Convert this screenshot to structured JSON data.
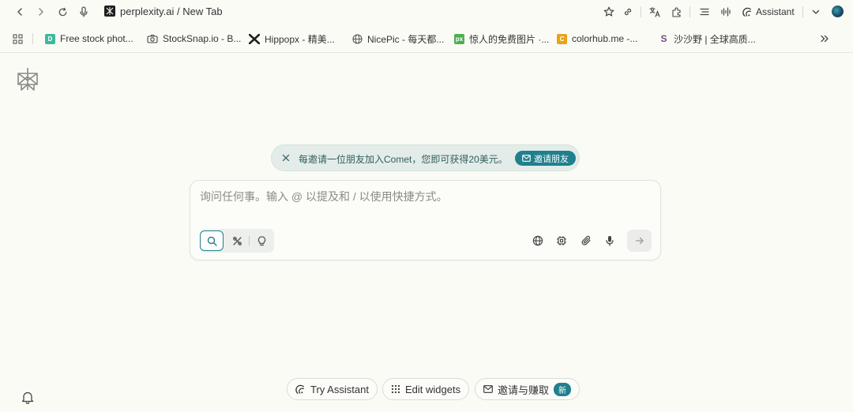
{
  "toolbar": {
    "tab_title": "perplexity.ai / New Tab",
    "assistant_label": "Assistant"
  },
  "bookmarks": [
    {
      "label": "Free stock phot...",
      "favicon_text": "D",
      "color": "#3fb8a0"
    },
    {
      "label": "StockSnap.io - B...",
      "favicon_text": "",
      "color": "#444444"
    },
    {
      "label": "Hippopx - 精美...",
      "favicon_text": "",
      "color": "#222222"
    },
    {
      "label": "NicePic - 每天都...",
      "favicon_text": "",
      "color": "#555555"
    },
    {
      "label": "惊人的免费图片 ·...",
      "favicon_text": "px",
      "color": "#4caf50"
    },
    {
      "label": "colorhub.me -...",
      "favicon_text": "C",
      "color": "#e8a317"
    },
    {
      "label": "沙沙野 | 全球高质...",
      "favicon_text": "S",
      "color": "#7a4a86"
    }
  ],
  "banner": {
    "text": "每邀请一位朋友加入Comet，您即可获得20美元。",
    "button_label": "邀请朋友"
  },
  "search": {
    "placeholder": "询问任何事。输入 @ 以提及和 / 以使用快捷方式。",
    "value": ""
  },
  "bottom": {
    "try_assistant": "Try Assistant",
    "edit_widgets": "Edit widgets",
    "invite_earn": "邀请与赚取",
    "new_badge": "新"
  },
  "colors": {
    "accent": "#20808d",
    "background": "#fbfbf6"
  }
}
